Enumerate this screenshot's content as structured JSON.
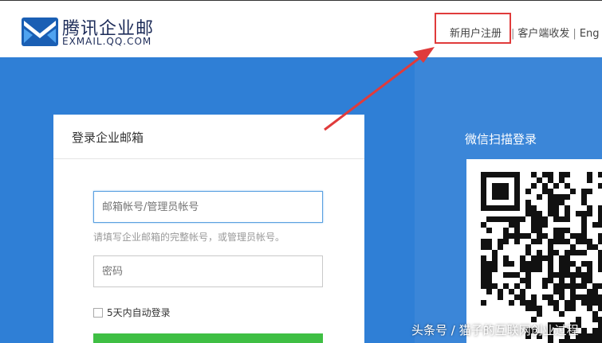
{
  "header": {
    "brand_cn": "腾讯企业邮",
    "brand_en": "EXMAIL.QQ.COM",
    "nav": {
      "register": "新用户注册",
      "client": "客户端收发",
      "separator": "|",
      "language": "Eng"
    }
  },
  "login": {
    "title": "登录企业邮箱",
    "account_placeholder": "邮箱帐号/管理员帐号",
    "account_hint": "请填写企业邮箱的完整帐号，或管理员帐号。",
    "password_placeholder": "密码",
    "remember_label": "5天内自动登录"
  },
  "wechat": {
    "title": "微信扫描登录"
  },
  "watermark": "头条号 / 猫子的互联网创业过程",
  "colors": {
    "hero_blue": "#2f7fd6",
    "annotation_red": "#e03b3b",
    "login_green": "#3fbf44",
    "brand_navy": "#1d2c59"
  },
  "icons": [
    "exmail-logo-icon",
    "checkbox-icon",
    "qr-code-icon",
    "annotation-arrow-icon"
  ]
}
